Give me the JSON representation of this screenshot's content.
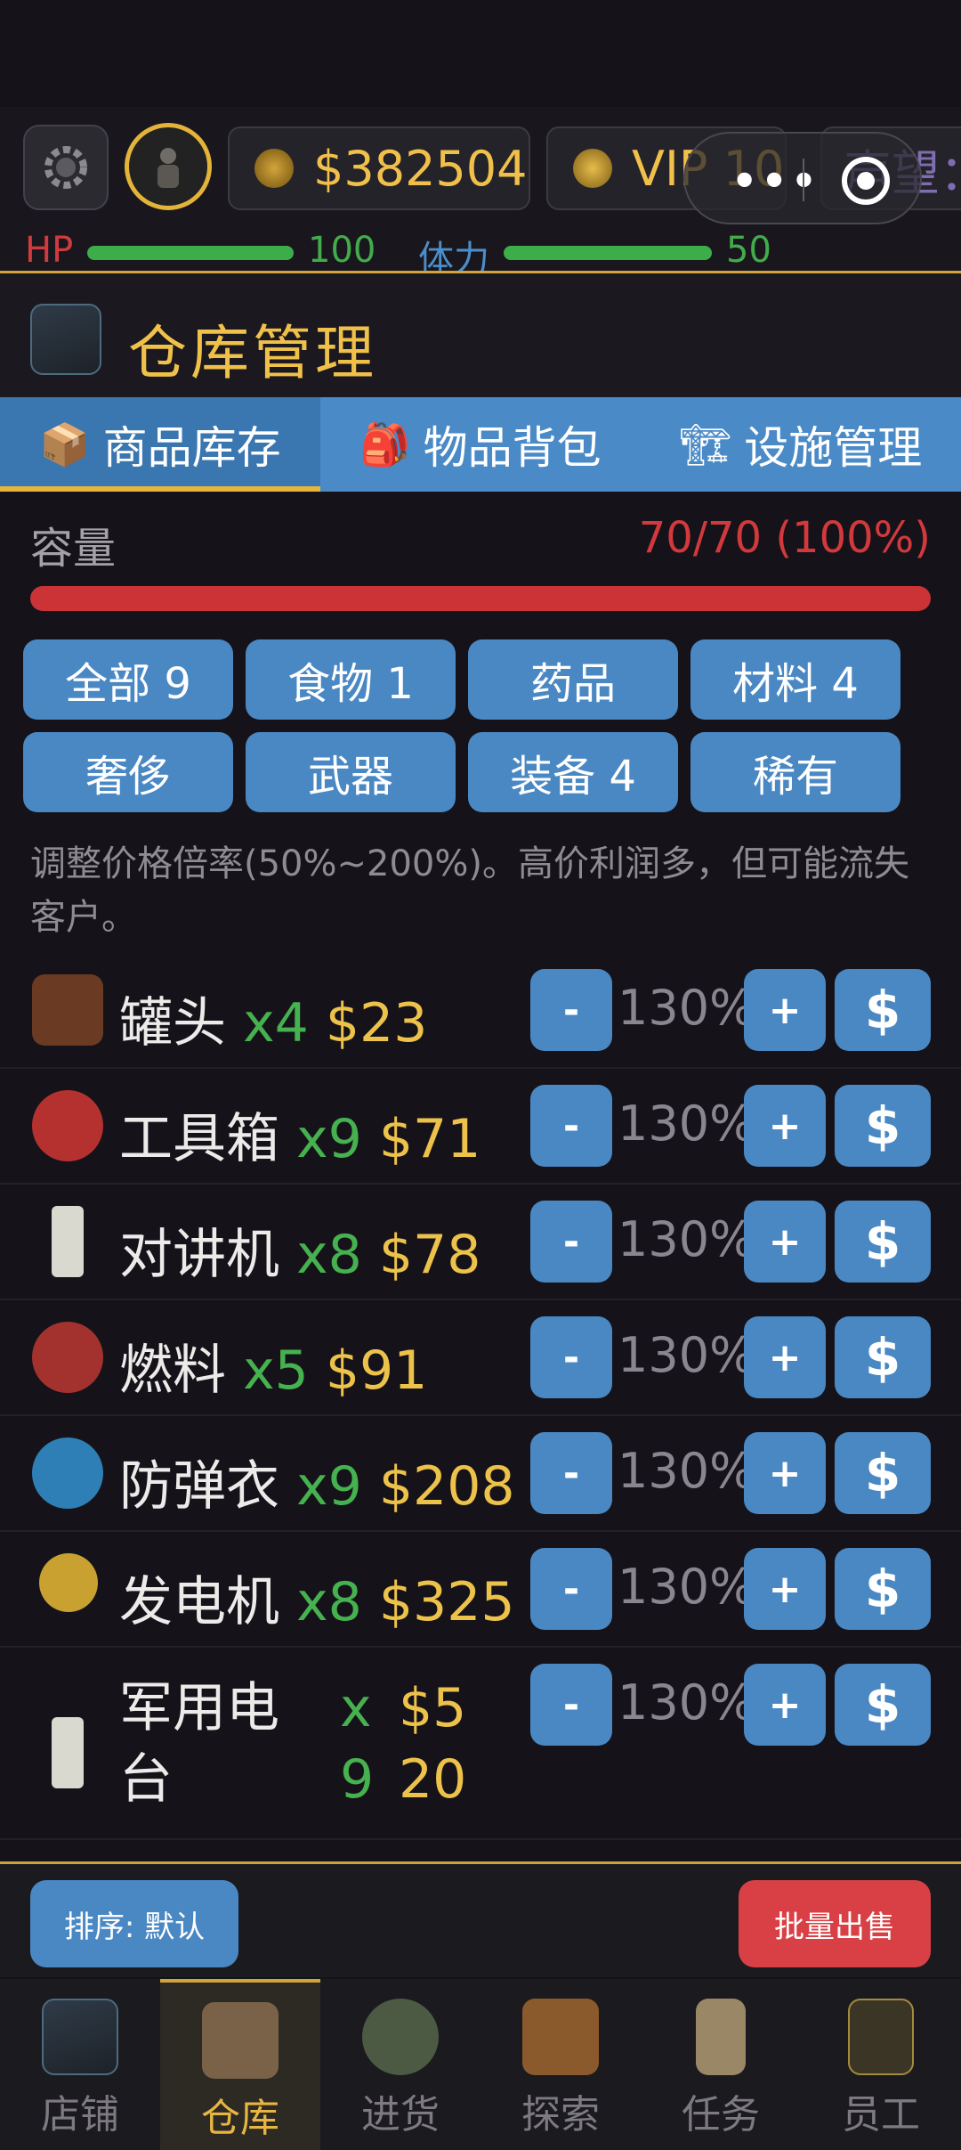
{
  "status": {
    "money": "$382504",
    "vip": "VIP 10",
    "reputation_partial": "声望：",
    "hp_label": "HP",
    "hp_value": "100",
    "stamina_label": "体力",
    "stamina_value": "50",
    "hp_fraction": 1.0,
    "stamina_fraction": 1.0
  },
  "header": {
    "title": "仓库管理"
  },
  "tabs": [
    {
      "label": "商品库存",
      "icon": "box-icon",
      "active": true
    },
    {
      "label": "物品背包",
      "icon": "backpack-icon",
      "active": false
    },
    {
      "label": "设施管理",
      "icon": "crane-icon",
      "active": false
    }
  ],
  "capacity": {
    "label": "容量",
    "value": "70/70 (100%)",
    "fraction": 1.0
  },
  "filters": [
    "全部 9",
    "食物 1",
    "药品",
    "材料 4",
    "奢侈",
    "武器",
    "装备 4",
    "稀有"
  ],
  "hint": "调整价格倍率(50%~200%)。高价利润多，但可能流失客户。",
  "controls": {
    "minus": "-",
    "plus": "+",
    "sell": "$"
  },
  "items": [
    {
      "name": "罐头",
      "qty": "x4",
      "price": "$23",
      "pct": "130%",
      "icon": "can-icon",
      "color": "#6b3a22"
    },
    {
      "name": "工具箱",
      "qty": "x9",
      "price": "$71",
      "pct": "130%",
      "icon": "toolbox-icon",
      "color": "#b5312f"
    },
    {
      "name": "对讲机",
      "qty": "x8",
      "price": "$78",
      "pct": "130%",
      "icon": "walkie-talkie-icon",
      "color": "#d9d9cf"
    },
    {
      "name": "燃料",
      "qty": "x5",
      "price": "$91",
      "pct": "130%",
      "icon": "fuel-icon",
      "color": "#a3322e"
    },
    {
      "name": "防弹衣",
      "qty": "x9",
      "price": "$208",
      "pct": "130%",
      "icon": "vest-shield-icon",
      "color": "#2e7fb5"
    },
    {
      "name": "发电机",
      "qty": "x8",
      "price": "$325",
      "pct": "130%",
      "icon": "energy-icon",
      "color": "#c8a130"
    },
    {
      "name": "军用电台",
      "name_line1": "军用电",
      "name_line2": "台",
      "qty": "x",
      "qty2": "9",
      "price": "$5",
      "price2": "20",
      "pct": "130%",
      "icon": "radio-icon",
      "color": "#d9d9cf"
    }
  ],
  "actions": {
    "sort": "排序: 默认",
    "bulk_sell": "批量出售"
  },
  "nav": [
    {
      "label": "店铺",
      "icon": "shop-icon",
      "active": false
    },
    {
      "label": "仓库",
      "icon": "warehouse-crate-icon",
      "active": true
    },
    {
      "label": "进货",
      "icon": "truck-icon",
      "active": false
    },
    {
      "label": "探索",
      "icon": "map-icon",
      "active": false
    },
    {
      "label": "任务",
      "icon": "clipboard-icon",
      "active": false
    },
    {
      "label": "员工",
      "icon": "team-icon",
      "active": false
    }
  ]
}
